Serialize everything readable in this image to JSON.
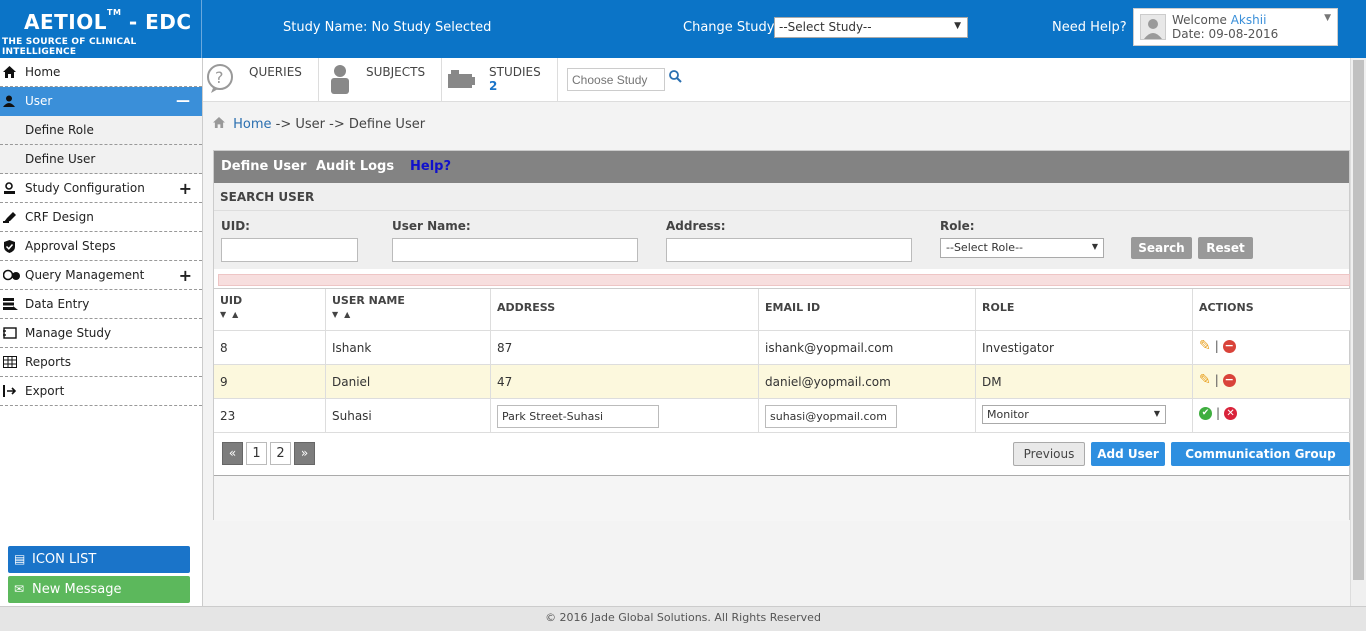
{
  "header": {
    "brand_title": "AETIOL",
    "brand_tm": "TM",
    "brand_suffix": " - EDC",
    "brand_sub": "THE SOURCE OF CLINICAL INTELLIGENCE",
    "study_name": "Study Name: No Study Selected",
    "change_study_label": "Change Study:",
    "study_select_value": "--Select Study--",
    "need_help": "Need Help?",
    "welcome_prefix": "Welcome",
    "welcome_name": "Akshii",
    "date_label": "Date: 09-08-2016"
  },
  "sidebar": {
    "items": [
      {
        "label": "Home",
        "icon": "home-icon"
      },
      {
        "label": "User",
        "icon": "user-icon"
      },
      {
        "label": "Define Role"
      },
      {
        "label": "Define User"
      },
      {
        "label": "Study Configuration",
        "icon": "study-config-icon"
      },
      {
        "label": "CRF Design",
        "icon": "crf-design-icon"
      },
      {
        "label": "Approval Steps",
        "icon": "approval-icon"
      },
      {
        "label": "Query Management",
        "icon": "query-icon"
      },
      {
        "label": "Data Entry",
        "icon": "data-entry-icon"
      },
      {
        "label": "Manage Study",
        "icon": "manage-study-icon"
      },
      {
        "label": "Reports",
        "icon": "reports-icon"
      },
      {
        "label": "Export",
        "icon": "export-icon"
      }
    ],
    "icon_list": "ICON LIST",
    "new_message": "New Message"
  },
  "topnav": {
    "queries": "QUERIES",
    "subjects": "SUBJECTS",
    "studies": "STUDIES",
    "studies_count": "2",
    "choose_study_placeholder": "Choose Study"
  },
  "breadcrumb": {
    "home": "Home",
    "rest": " -> User -> Define User"
  },
  "panel": {
    "tab_define_user": "Define User",
    "tab_audit_logs": "Audit Logs",
    "tab_help": "Help?",
    "search_title": "SEARCH USER",
    "uid_label": "UID:",
    "username_label": "User Name:",
    "address_label": "Address:",
    "role_label": "Role:",
    "role_select": "--Select Role--",
    "search_btn": "Search",
    "reset_btn": "Reset"
  },
  "table": {
    "headers": [
      "UID",
      "USER NAME",
      "ADDRESS",
      "EMAIL ID",
      "ROLE",
      "ACTIONS"
    ],
    "rows": [
      {
        "uid": "8",
        "name": "Ishank",
        "address": "87",
        "email": "ishank@yopmail.com",
        "role": "Investigator"
      },
      {
        "uid": "9",
        "name": "Daniel",
        "address": "47",
        "email": "daniel@yopmail.com",
        "role": "DM"
      },
      {
        "uid": "23",
        "name": "Suhasi",
        "address": "Park Street-Suhasi",
        "email": "suhasi@yopmail.com",
        "role": "Monitor"
      }
    ]
  },
  "pager": {
    "first": "«",
    "page1": "1",
    "page2": "2",
    "last": "»",
    "previous": "Previous",
    "add_user": "Add User",
    "comm_group": "Communication Group List"
  },
  "footer": "© 2016 Jade Global Solutions. All Rights Reserved",
  "colors": {
    "header_blue": "#0b74c7",
    "active_nav": "#3a8fd9",
    "panel_head": "#838383",
    "highlight_row": "#fcf8dd"
  }
}
